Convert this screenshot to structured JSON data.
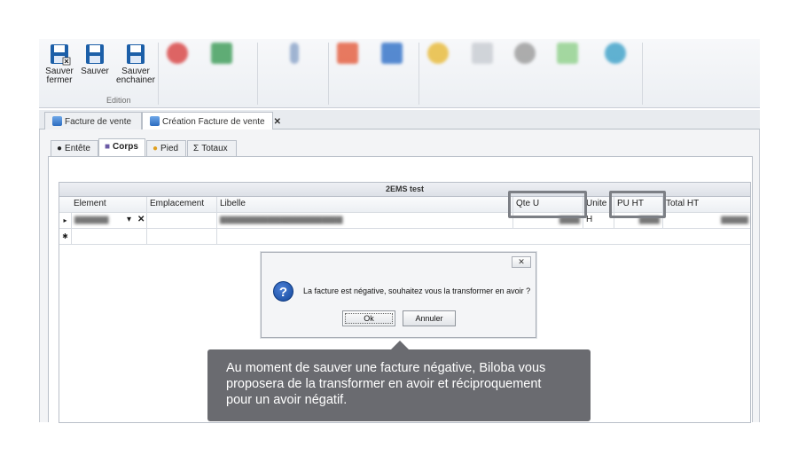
{
  "ribbon": {
    "buttons": [
      {
        "label_line1": "Sauver",
        "label_line2": "fermer"
      },
      {
        "label_line1": "Sauver",
        "label_line2": ""
      },
      {
        "label_line1": "Sauver",
        "label_line2": "enchainer"
      }
    ],
    "group_label": "Edition",
    "colors": {
      "save_icon": "#1c5fa8",
      "ribbon_bg": "#eef0f3"
    }
  },
  "doc_tabs": [
    {
      "label": "Facture de vente",
      "icon": "document-icon"
    },
    {
      "label": "Création Facture de vente",
      "icon": "document-icon",
      "close": "✕"
    }
  ],
  "inner_tabs": [
    {
      "label": "Entête",
      "icon": "header-icon"
    },
    {
      "label": "Corps",
      "icon": "body-icon"
    },
    {
      "label": "Pied",
      "icon": "footer-icon"
    },
    {
      "label": "Totaux",
      "icon": "sigma-icon",
      "glyph": "Σ"
    }
  ],
  "grid": {
    "title": "2EMS test",
    "columns": [
      "Element",
      "Emplacement",
      "Libelle",
      "Qte U",
      "Unite",
      "PU HT",
      "Total HT"
    ],
    "row1": {
      "indicator": "▸",
      "unite": "H",
      "clear": "✕",
      "dropdown": "▾"
    },
    "new_row_indicator": "✱"
  },
  "dialog": {
    "close": "✕",
    "icon": "?",
    "message": "La facture est négative, souhaitez vous la transformer en avoir ?",
    "ok": "Ok",
    "cancel": "Annuler"
  },
  "tooltip": {
    "line1": "Au moment de sauver une facture négative, Biloba vous",
    "line2": "proposera de la transformer en avoir et réciproquement",
    "line3": "pour un avoir négatif."
  }
}
